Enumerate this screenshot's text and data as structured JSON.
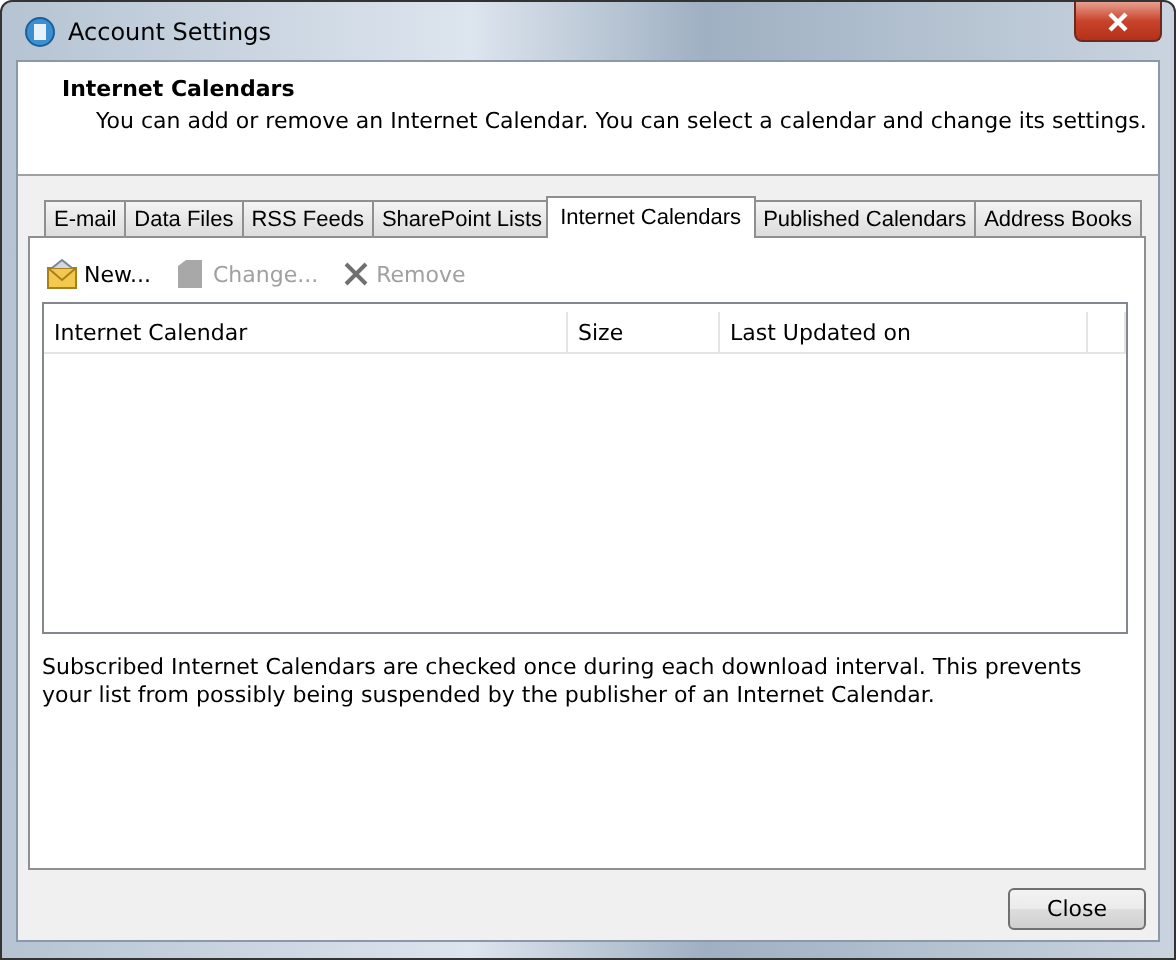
{
  "window": {
    "title": "Account Settings"
  },
  "header": {
    "title": "Internet Calendars",
    "description": "You can add or remove an Internet Calendar. You can select a calendar and change its settings."
  },
  "tabs": [
    {
      "label": "E-mail",
      "selected": false
    },
    {
      "label": "Data Files",
      "selected": false
    },
    {
      "label": "RSS Feeds",
      "selected": false
    },
    {
      "label": "SharePoint Lists",
      "selected": false
    },
    {
      "label": "Internet Calendars",
      "selected": true
    },
    {
      "label": "Published Calendars",
      "selected": false
    },
    {
      "label": "Address Books",
      "selected": false
    }
  ],
  "toolbar": [
    {
      "kind": "new",
      "label": "New...",
      "disabled": false
    },
    {
      "kind": "change",
      "label": "Change...",
      "disabled": true
    },
    {
      "kind": "remove",
      "label": "Remove",
      "disabled": true
    }
  ],
  "table": {
    "columns": [
      "Internet Calendar",
      "Size",
      "Last Updated on"
    ]
  },
  "note": "Subscribed Internet Calendars are checked once during each download interval. This prevents your list from possibly being suspended by the publisher of an Internet Calendar.",
  "buttons": [
    "Close"
  ]
}
